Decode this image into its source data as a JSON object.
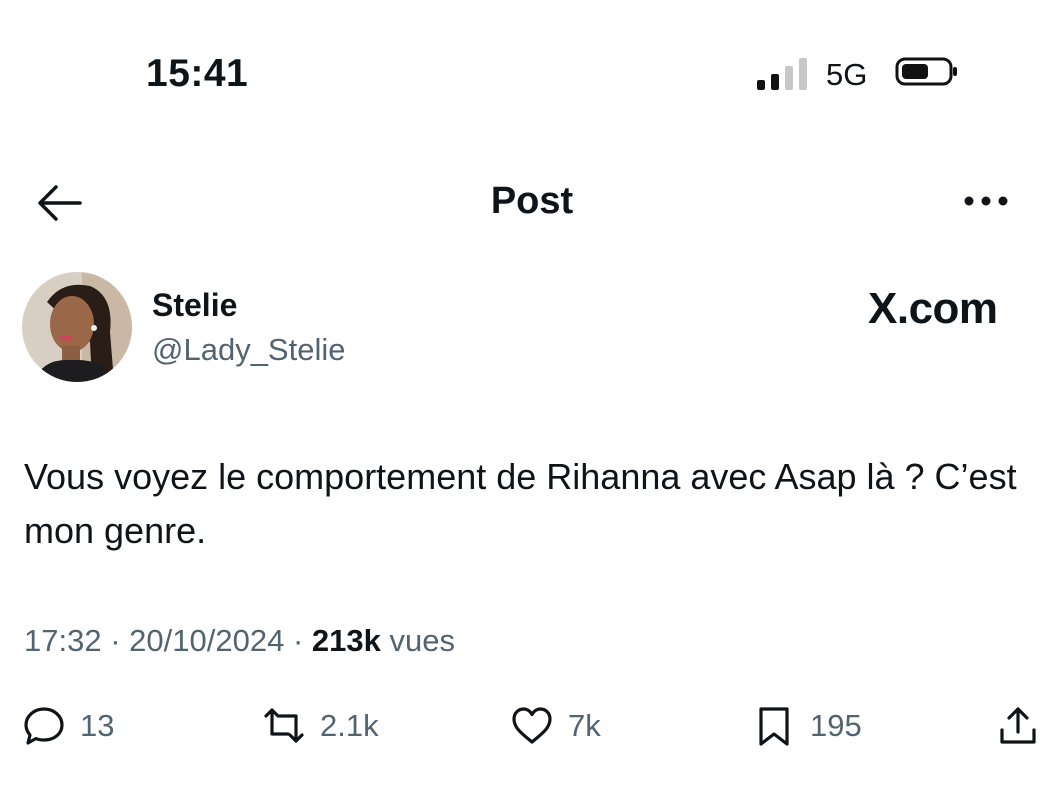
{
  "status_bar": {
    "time": "15:41",
    "network": "5G",
    "icons": [
      "signal-icon",
      "battery-icon"
    ]
  },
  "nav": {
    "title": "Post",
    "icons": [
      "back-arrow-icon",
      "more-icon"
    ]
  },
  "author": {
    "name": "Stelie",
    "handle": "@Lady_Stelie",
    "avatar_icon": "avatar"
  },
  "watermark": "X.com",
  "tweet": {
    "text": "Vous voyez le comportement de Rihanna avec Asap là ? C’est mon genre."
  },
  "meta": {
    "time": "17:32",
    "separator": "·",
    "date": "20/10/2024",
    "views": "213k",
    "views_label": "vues"
  },
  "actions": {
    "replies": "13",
    "reposts": "2.1k",
    "likes": "7k",
    "bookmarks": "195",
    "icons": [
      "reply-icon",
      "repost-icon",
      "like-icon",
      "bookmark-icon",
      "share-icon"
    ]
  },
  "colors": {
    "text": "#0f1419",
    "secondary": "#536471",
    "background": "#ffffff"
  }
}
